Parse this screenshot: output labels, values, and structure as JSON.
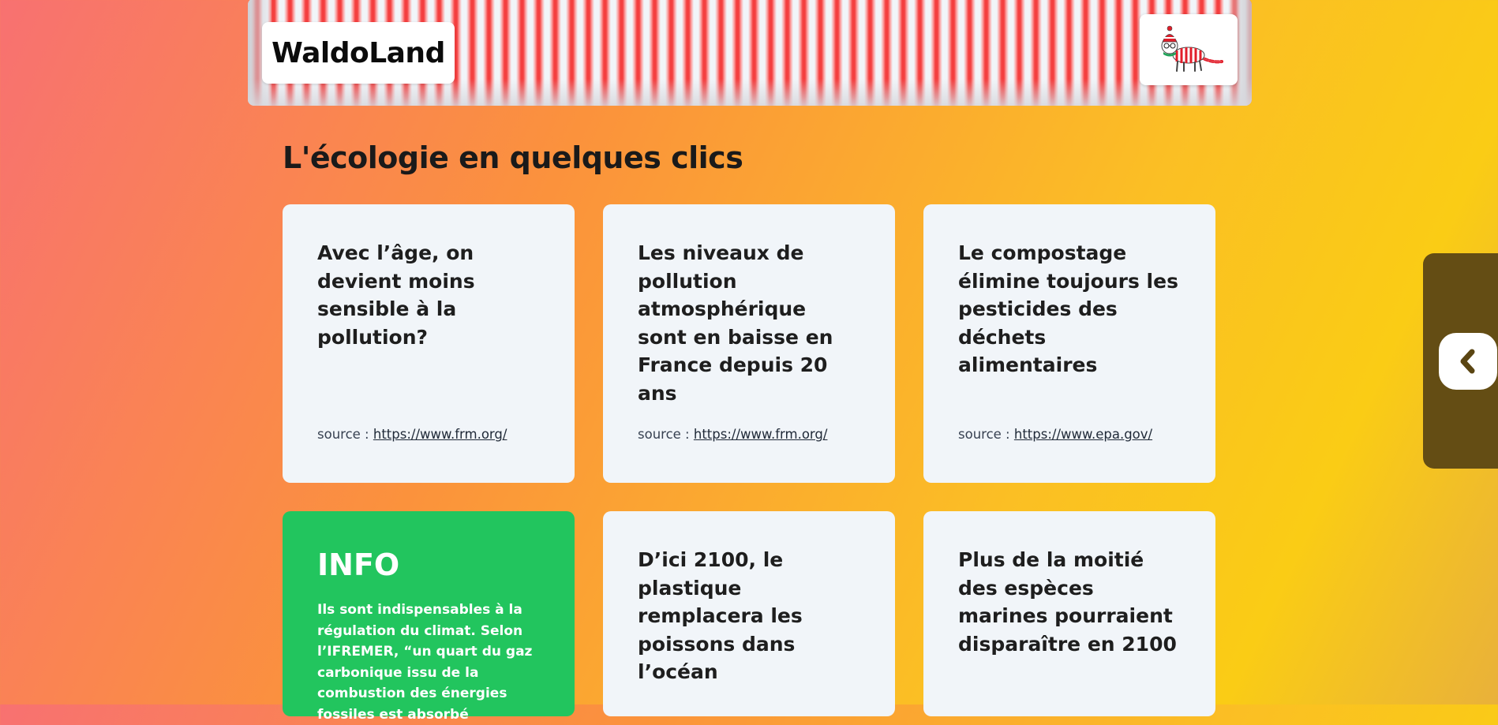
{
  "header": {
    "logo_text": "WaldoLand",
    "avatar_icon": "waldo-cat-icon"
  },
  "page": {
    "title": "L'écologie en quelques clics"
  },
  "cards": [
    {
      "text": "Avec l’âge, on devient moins sensible à la pollution?",
      "source_label": "source :",
      "source_link": "https://www.frm.org/"
    },
    {
      "text": "Les niveaux de pollution atmosphérique sont en baisse en France depuis 20 ans",
      "source_label": "source :",
      "source_link": "https://www.frm.org/"
    },
    {
      "text": "Le compostage élimine toujours les pesticides des déchets alimentaires",
      "source_label": "source :",
      "source_link": "https://www.epa.gov/"
    },
    {
      "text": "D’ici 2100, le plastique remplacera les poissons dans l’océan"
    },
    {
      "text": "Plus de la moitié des espèces marines pourraient disparaître en 2100"
    }
  ],
  "info_card": {
    "title": "INFO",
    "body": "Ils sont indispensables à la régulation du climat. Selon l’IFREMER, “un quart du gaz carbonique issu de la combustion des énergies fossiles est absorbé"
  },
  "side_panel": {
    "button_icon": "chevron-left-icon"
  },
  "colors": {
    "card_bg": "#f1f5f9",
    "info_bg": "#22c55e",
    "panel_bg": "#644d14",
    "stripe_red": "#f43f3f"
  }
}
